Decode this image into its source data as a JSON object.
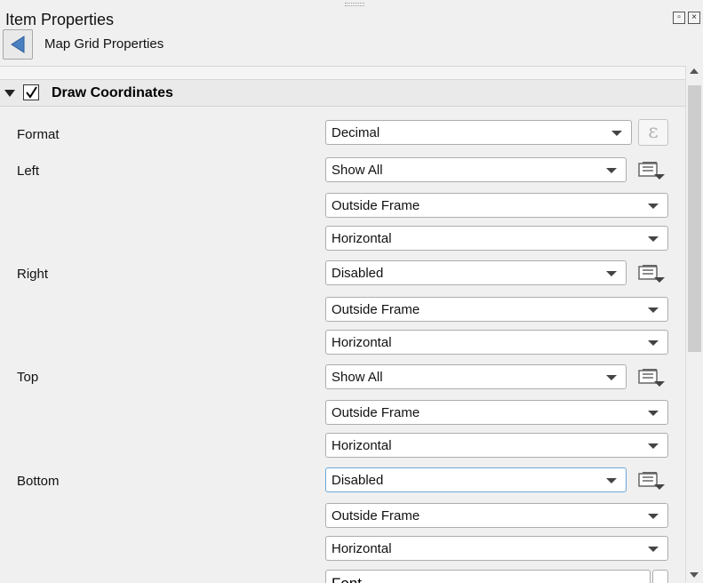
{
  "window": {
    "title": "Item Properties"
  },
  "panel": {
    "title": "Map Grid Properties"
  },
  "group": {
    "title": "Draw Coordinates",
    "checked": true
  },
  "rows": {
    "format": {
      "label": "Format",
      "value": "Decimal"
    },
    "left": {
      "label": "Left",
      "display": "Show All",
      "position": "Outside Frame",
      "direction": "Horizontal"
    },
    "right": {
      "label": "Right",
      "display": "Disabled",
      "position": "Outside Frame",
      "direction": "Horizontal"
    },
    "top": {
      "label": "Top",
      "display": "Show All",
      "position": "Outside Frame",
      "direction": "Horizontal"
    },
    "bottom": {
      "label": "Bottom",
      "display": "Disabled",
      "position": "Outside Frame",
      "direction": "Horizontal"
    }
  },
  "expression_button": {
    "glyph": "ε"
  },
  "font_button": {
    "label": "Font"
  },
  "icons": {
    "back": "back-arrow-icon",
    "collapse": "triangle-down-icon",
    "data_defined": "data-defined-override-icon",
    "float": "float-window-icon",
    "close": "close-icon"
  }
}
